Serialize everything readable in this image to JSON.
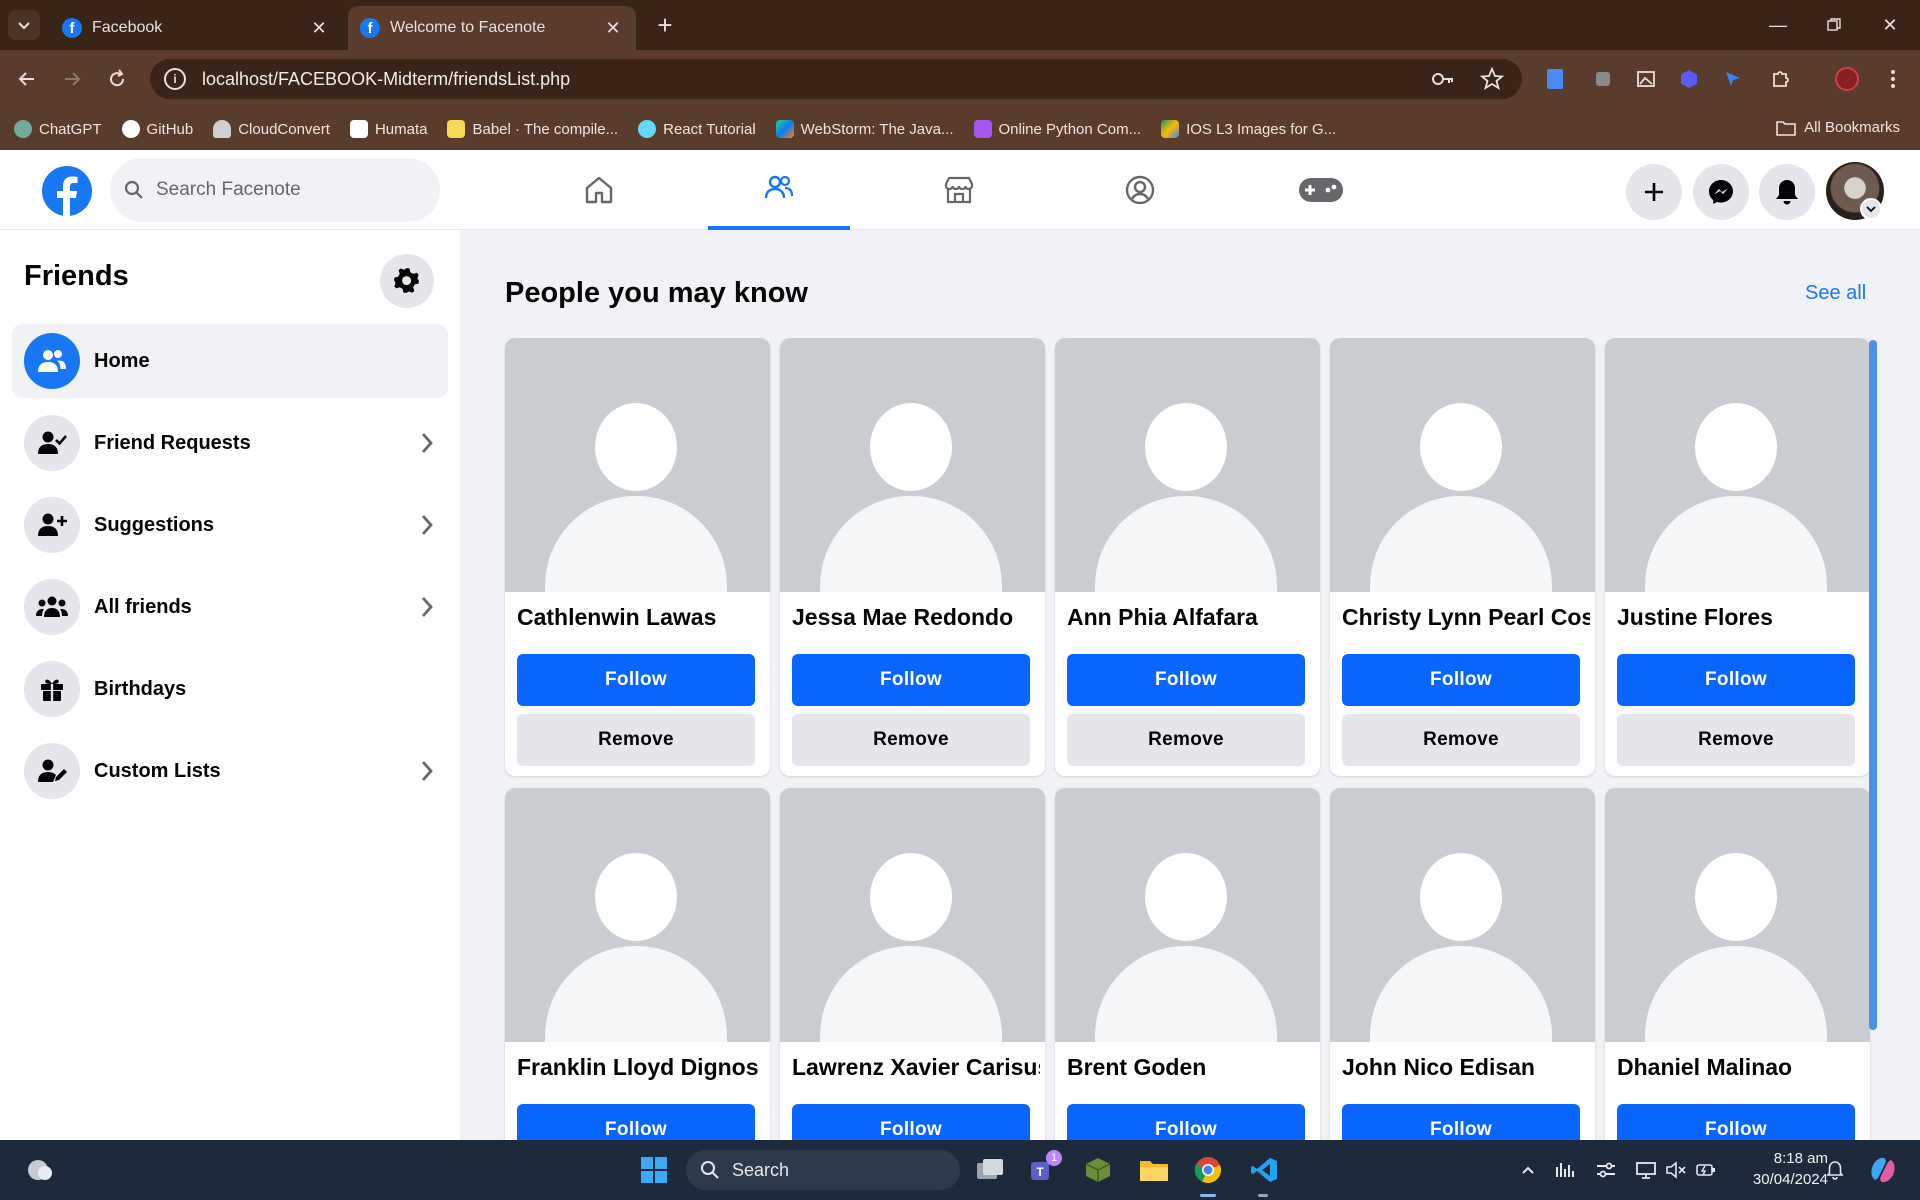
{
  "browser": {
    "tabs": [
      {
        "title": "Facebook",
        "favicon": "f",
        "active": false
      },
      {
        "title": "Welcome to Facenote",
        "favicon": "f",
        "active": true
      }
    ],
    "url": "localhost/FACEBOOK-Midterm/friendsList.php",
    "bookmarks": [
      {
        "label": "ChatGPT",
        "icon": "chatgpt-icon",
        "color": "#74aa9c"
      },
      {
        "label": "GitHub",
        "icon": "github-icon",
        "color": "#ffffff"
      },
      {
        "label": "CloudConvert",
        "icon": "cloud-icon",
        "color": "#cfcfcf"
      },
      {
        "label": "Humata",
        "icon": "humata-icon",
        "color": "#ffffff"
      },
      {
        "label": "Babel · The compile...",
        "icon": "babel-icon",
        "color": "#f5da55"
      },
      {
        "label": "React Tutorial",
        "icon": "react-icon",
        "color": "#61dafb"
      },
      {
        "label": "WebStorm: The Java...",
        "icon": "webstorm-icon",
        "color": "#21d789"
      },
      {
        "label": "Online Python Com...",
        "icon": "python-icon",
        "color": "#a855f7"
      },
      {
        "label": "IOS L3 Images for G...",
        "icon": "drive-icon",
        "color": "#fbbc04"
      }
    ],
    "all_bookmarks": "All Bookmarks"
  },
  "facebook": {
    "search_placeholder": "Search Facenote",
    "brand_color": "#1877f2"
  },
  "sidebar": {
    "title": "Friends",
    "items": [
      {
        "label": "Home",
        "icon": "friends-icon",
        "active": true,
        "chevron": false
      },
      {
        "label": "Friend Requests",
        "icon": "friend-check-icon",
        "active": false,
        "chevron": true
      },
      {
        "label": "Suggestions",
        "icon": "add-friend-icon",
        "active": false,
        "chevron": true
      },
      {
        "label": "All friends",
        "icon": "group-icon",
        "active": false,
        "chevron": true
      },
      {
        "label": "Birthdays",
        "icon": "gift-icon",
        "active": false,
        "chevron": false
      },
      {
        "label": "Custom Lists",
        "icon": "edit-user-icon",
        "active": false,
        "chevron": true
      }
    ]
  },
  "main": {
    "section_title": "People you may know",
    "see_all": "See all",
    "follow_label": "Follow",
    "remove_label": "Remove",
    "people": [
      "Cathlenwin Lawas",
      "Jessa Mae Redondo",
      "Ann Phia Alfafara",
      "Christy Lynn Pearl Cos",
      "Justine Flores",
      "Franklin Lloyd Dignos",
      "Lawrenz Xavier Carisus",
      "Brent Goden",
      "John Nico Edisan",
      "Dhaniel Malinao"
    ]
  },
  "taskbar": {
    "search_label": "Search",
    "time": "8:18 am",
    "date": "30/04/2024",
    "teams_badge": "1"
  }
}
